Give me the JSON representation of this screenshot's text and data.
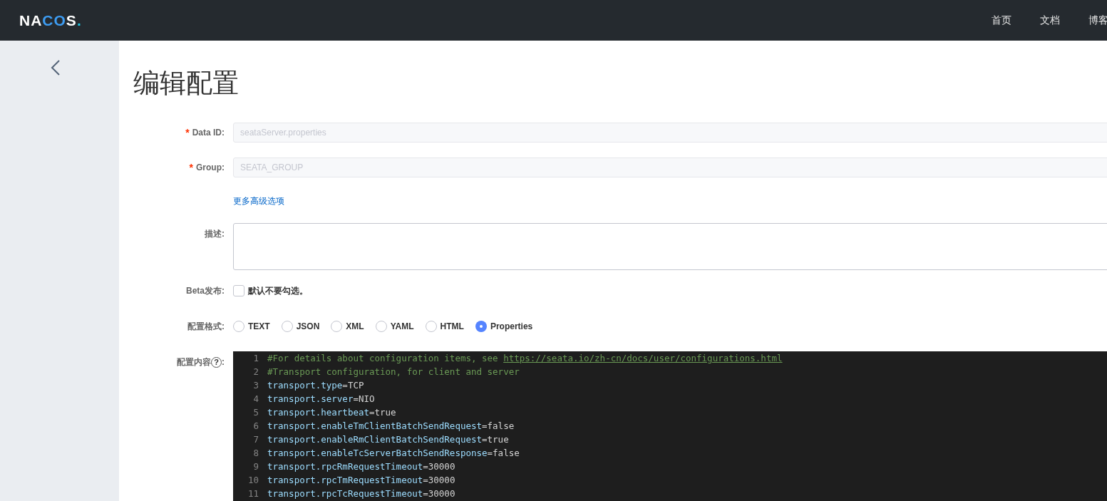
{
  "header": {
    "logo": "NACOS.",
    "nav": [
      "首页",
      "文档",
      "博客"
    ]
  },
  "page": {
    "title": "编辑配置"
  },
  "form": {
    "data_id": {
      "label": "Data ID:",
      "required_mark": "*",
      "value": "seataServer.properties",
      "disabled": true
    },
    "group": {
      "label": "Group:",
      "required_mark": "*",
      "value": "SEATA_GROUP",
      "disabled": true
    },
    "advanced_link": "更多高级选项",
    "description": {
      "label": "描述:"
    },
    "beta": {
      "label": "Beta发布:",
      "checked": false,
      "text": "默认不要勾选。"
    },
    "format": {
      "label": "配置格式:",
      "options": [
        {
          "label": "TEXT",
          "selected": false
        },
        {
          "label": "JSON",
          "selected": false
        },
        {
          "label": "XML",
          "selected": false
        },
        {
          "label": "YAML",
          "selected": false
        },
        {
          "label": "HTML",
          "selected": false
        },
        {
          "label": "Properties",
          "selected": true
        }
      ]
    },
    "content": {
      "label": "配置内容",
      "help": "?",
      "colon": ":",
      "lines": [
        {
          "number": "1",
          "kind": "comment",
          "text": "#For details about configuration items, see ",
          "link": "https://seata.io/zh-cn/docs/user/configurations.html"
        },
        {
          "number": "2",
          "kind": "comment",
          "text": "#Transport configuration, for client and server"
        },
        {
          "number": "3",
          "kind": "property",
          "key": "transport.type",
          "operator": "=",
          "value": "TCP"
        },
        {
          "number": "4",
          "kind": "property",
          "key": "transport.server",
          "operator": "=",
          "value": "NIO"
        },
        {
          "number": "5",
          "kind": "property",
          "key": "transport.heartbeat",
          "operator": "=",
          "value": "true"
        },
        {
          "number": "6",
          "kind": "property",
          "key": "transport.enableTmClientBatchSendRequest",
          "operator": "=",
          "value": "false"
        },
        {
          "number": "7",
          "kind": "property",
          "key": "transport.enableRmClientBatchSendRequest",
          "operator": "=",
          "value": "true"
        },
        {
          "number": "8",
          "kind": "property",
          "key": "transport.enableTcServerBatchSendResponse",
          "operator": "=",
          "value": "false"
        },
        {
          "number": "9",
          "kind": "property",
          "key": "transport.rpcRmRequestTimeout",
          "operator": "=",
          "value": "30000"
        },
        {
          "number": "10",
          "kind": "property",
          "key": "transport.rpcTmRequestTimeout",
          "operator": "=",
          "value": "30000"
        },
        {
          "number": "11",
          "kind": "property",
          "key": "transport.rpcTcRequestTimeout",
          "operator": "=",
          "value": "30000"
        }
      ]
    }
  }
}
